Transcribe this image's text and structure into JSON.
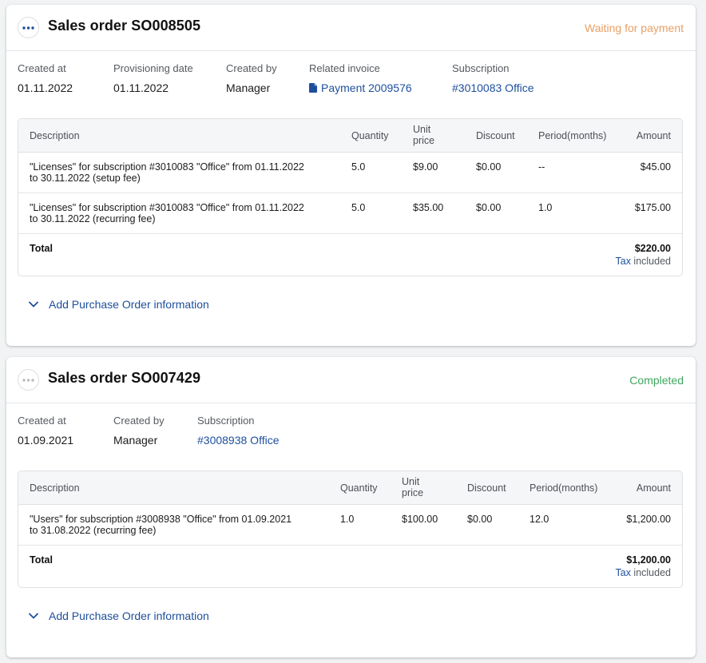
{
  "orders": [
    {
      "title": "Sales order SO008505",
      "status": "Waiting for payment",
      "status_color": "#e8a065",
      "meta": {
        "created_at_label": "Created at",
        "created_at": "01.11.2022",
        "provisioning_label": "Provisioning date",
        "provisioning": "01.11.2022",
        "created_by_label": "Created by",
        "created_by": "Manager",
        "invoice_label": "Related invoice",
        "invoice": "Payment 2009576",
        "subscription_label": "Subscription",
        "subscription": "#3010083 Office"
      },
      "table": {
        "headers": {
          "description": "Description",
          "quantity": "Quantity",
          "unit_price_1": "Unit",
          "unit_price_2": "price",
          "discount": "Discount",
          "period": "Period(months)",
          "amount": "Amount"
        },
        "rows": [
          {
            "description_1": "\"Licenses\" for subscription #3010083 \"Office\" from 01.11.2022",
            "description_2": "to 30.11.2022 (setup fee)",
            "quantity": "5.0",
            "unit_price": "$9.00",
            "discount": "$0.00",
            "period": "--",
            "amount": "$45.00"
          },
          {
            "description_1": "\"Licenses\" for subscription #3010083 \"Office\" from 01.11.2022",
            "description_2": "to 30.11.2022 (recurring fee)",
            "quantity": "5.0",
            "unit_price": "$35.00",
            "discount": "$0.00",
            "period": "1.0",
            "amount": "$175.00"
          }
        ],
        "total_label": "Total",
        "total_amount": "$220.00",
        "tax_link": "Tax",
        "tax_suffix": " included"
      },
      "po_link": "Add Purchase Order information"
    },
    {
      "title": "Sales order SO007429",
      "status": "Completed",
      "status_color": "#3fa65f",
      "meta": {
        "created_at_label": "Created at",
        "created_at": "01.09.2021",
        "created_by_label": "Created by",
        "created_by": "Manager",
        "subscription_label": "Subscription",
        "subscription": "#3008938 Office"
      },
      "table": {
        "headers": {
          "description": "Description",
          "quantity": "Quantity",
          "unit_price_1": "Unit",
          "unit_price_2": "price",
          "discount": "Discount",
          "period": "Period(months)",
          "amount": "Amount"
        },
        "rows": [
          {
            "description_1": "\"Users\" for subscription #3008938 \"Office\" from 01.09.2021",
            "description_2": "to 31.08.2022 (recurring fee)",
            "quantity": "1.0",
            "unit_price": "$100.00",
            "discount": "$0.00",
            "period": "12.0",
            "amount": "$1,200.00"
          }
        ],
        "total_label": "Total",
        "total_amount": "$1,200.00",
        "tax_link": "Tax",
        "tax_suffix": " included"
      },
      "po_link": "Add Purchase Order information"
    }
  ],
  "icons": {
    "more": "more-horizontal-icon",
    "document": "document-icon",
    "chevron": "chevron-down-icon"
  },
  "colors": {
    "link": "#1e4f9c",
    "border": "#dfe0e3"
  }
}
